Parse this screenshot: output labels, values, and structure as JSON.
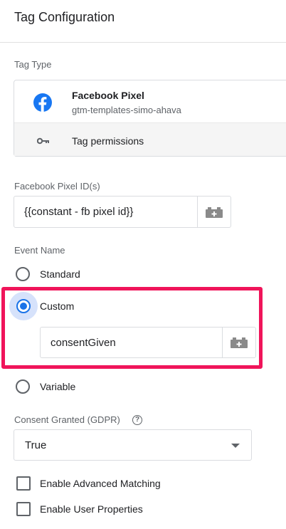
{
  "header": {
    "title": "Tag Configuration"
  },
  "tag_type": {
    "label": "Tag Type",
    "name": "Facebook Pixel",
    "template": "gtm-templates-simo-ahava",
    "permissions_label": "Tag permissions"
  },
  "pixel_id": {
    "label": "Facebook Pixel ID(s)",
    "value": "{{constant - fb pixel id}}"
  },
  "event_name": {
    "label": "Event Name",
    "options": [
      "Standard",
      "Custom",
      "Variable"
    ],
    "selected": "Custom",
    "custom_value": "consentGiven"
  },
  "consent": {
    "label": "Consent Granted (GDPR)",
    "help": "?",
    "value": "True"
  },
  "checkboxes": [
    {
      "label": "Enable Advanced Matching",
      "checked": false
    },
    {
      "label": "Enable User Properties",
      "checked": false
    }
  ],
  "colors": {
    "facebook": "#1877f2",
    "radio_selected": "#1a73e8",
    "highlight": "#f0145a"
  },
  "icons": {
    "tag": "facebook-icon",
    "permissions": "key-icon",
    "variable": "variable-block-icon",
    "select": "caret-down-icon",
    "help": "help-circle-icon"
  }
}
